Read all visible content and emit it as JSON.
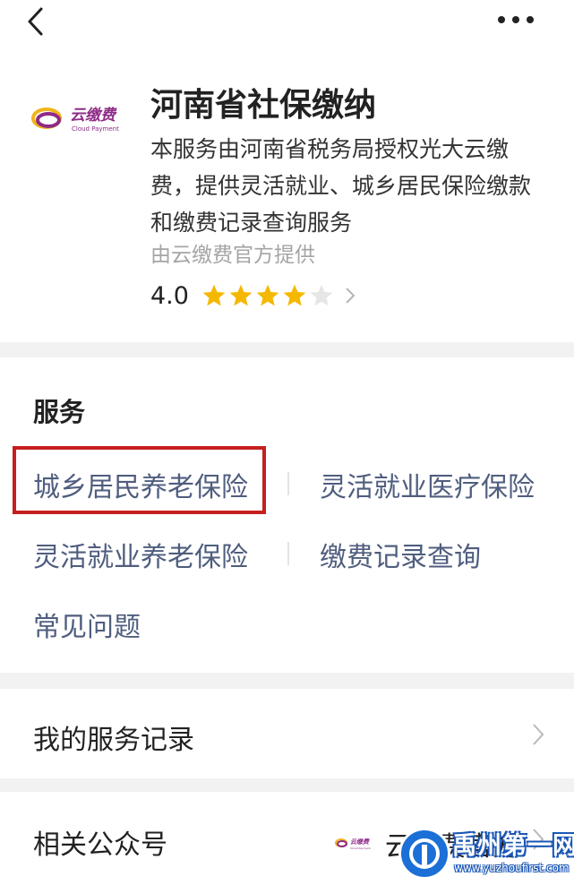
{
  "header": {
    "logo_text": "云缴费",
    "logo_subtext": "Cloud Payment",
    "title": "河南省社保缴纳",
    "description": "本服务由河南省税务局授权光大云缴费，提供灵活就业、城乡居民保险缴款和缴费记录查询服务",
    "provider": "由云缴费官方提供",
    "rating": "4.0",
    "rating_stars": 4,
    "rating_max": 5
  },
  "services": {
    "title": "服务",
    "items": [
      {
        "label": "城乡居民养老保险",
        "highlighted": true
      },
      {
        "label": "灵活就业医疗保险"
      },
      {
        "label": "灵活就业养老保险"
      },
      {
        "label": "缴费记录查询"
      },
      {
        "label": "常见问题"
      }
    ]
  },
  "records": {
    "label": "我的服务记录"
  },
  "related": {
    "label": "相关公众号",
    "account_name": "云缴费官方",
    "mini_logo_text": "云缴费",
    "mini_logo_subtext": "Cloud Payment"
  },
  "watermark": {
    "title": "禹州第一网",
    "url": "www.yuzhoufirst.com"
  },
  "colors": {
    "link": "#4f5d7e",
    "star": "#f5b800",
    "star_empty": "#e6e6e6",
    "highlight_border": "#c51f1f",
    "logo_accent": "#8e2b86"
  }
}
